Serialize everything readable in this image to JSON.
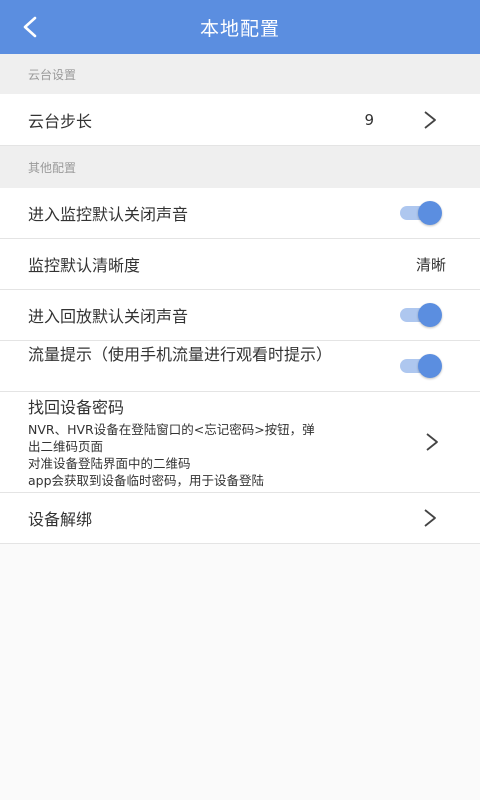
{
  "header": {
    "title": "本地配置",
    "back_icon": "chevron-left-icon",
    "color": "#5b8ee0"
  },
  "sections": {
    "ptz": {
      "title": "云台设置"
    },
    "other": {
      "title": "其他配置"
    }
  },
  "ptz_step": {
    "label": "云台步长",
    "value": "9"
  },
  "mute_live": {
    "label": "进入监控默认关闭声音",
    "enabled": true
  },
  "default_quality": {
    "label": "监控默认清晰度",
    "value": "清晰"
  },
  "mute_playback": {
    "label": "进入回放默认关闭声音",
    "enabled": true
  },
  "data_warning": {
    "label": "流量提示（使用手机流量进行观看时提示）",
    "enabled": true
  },
  "find_password": {
    "title": "找回设备密码",
    "desc": [
      "NVR、HVR设备在登陆窗口的<忘记密码>按钮，弹",
      "出二维码页面",
      " 对准设备登陆界面中的二维码",
      " app会获取到设备临时密码，用于设备登陆"
    ]
  },
  "unbind": {
    "label": "设备解绑"
  },
  "colors": {
    "accent": "#5b8ee0",
    "toggle_track": "#aec7ef",
    "section_bg": "#efefef"
  }
}
